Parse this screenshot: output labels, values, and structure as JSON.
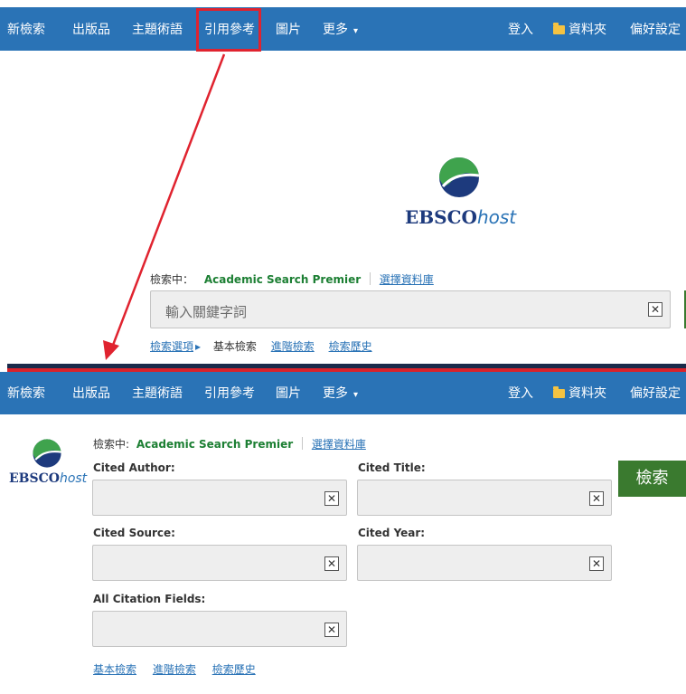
{
  "nav": {
    "new_search": "新檢索",
    "publications": "出版品",
    "subject_terms": "主題術語",
    "cited_references": "引用參考",
    "images": "圖片",
    "more": "更多",
    "more_caret": "▾",
    "sign_in": "登入",
    "folder": "資料夾",
    "preferences": "偏好設定"
  },
  "logo": {
    "brand": "EBSCO",
    "host": "host"
  },
  "basic": {
    "searching_label": "檢索中：",
    "database": "Academic Search Premier",
    "choose_databases": "選擇資料庫",
    "search_placeholder": "輸入關鍵字詞",
    "search_options": "檢索選項",
    "search_options_arrow": "▸",
    "basic_search": "基本檢索",
    "advanced_search": "進階檢索",
    "search_history": "檢索歷史",
    "clear_icon": "✕"
  },
  "cited": {
    "searching_label": "檢索中:",
    "database": "Academic Search Premier",
    "choose_databases": "選擇資料庫",
    "fields": {
      "cited_author": "Cited Author:",
      "cited_title": "Cited Title:",
      "cited_source": "Cited Source:",
      "cited_year": "Cited Year:",
      "all_citation_fields": "All Citation Fields:"
    },
    "search_button": "檢索",
    "basic_search": "基本檢索",
    "advanced_search": "進階檢索",
    "search_history": "檢索歷史",
    "clear_icon": "✕"
  },
  "colors": {
    "nav_blue": "#2a73b6",
    "db_green": "#1c7f33",
    "search_button_green": "#3a7a2f",
    "annotation_red": "#e0232f",
    "logo_navy": "#1d3a7d"
  }
}
